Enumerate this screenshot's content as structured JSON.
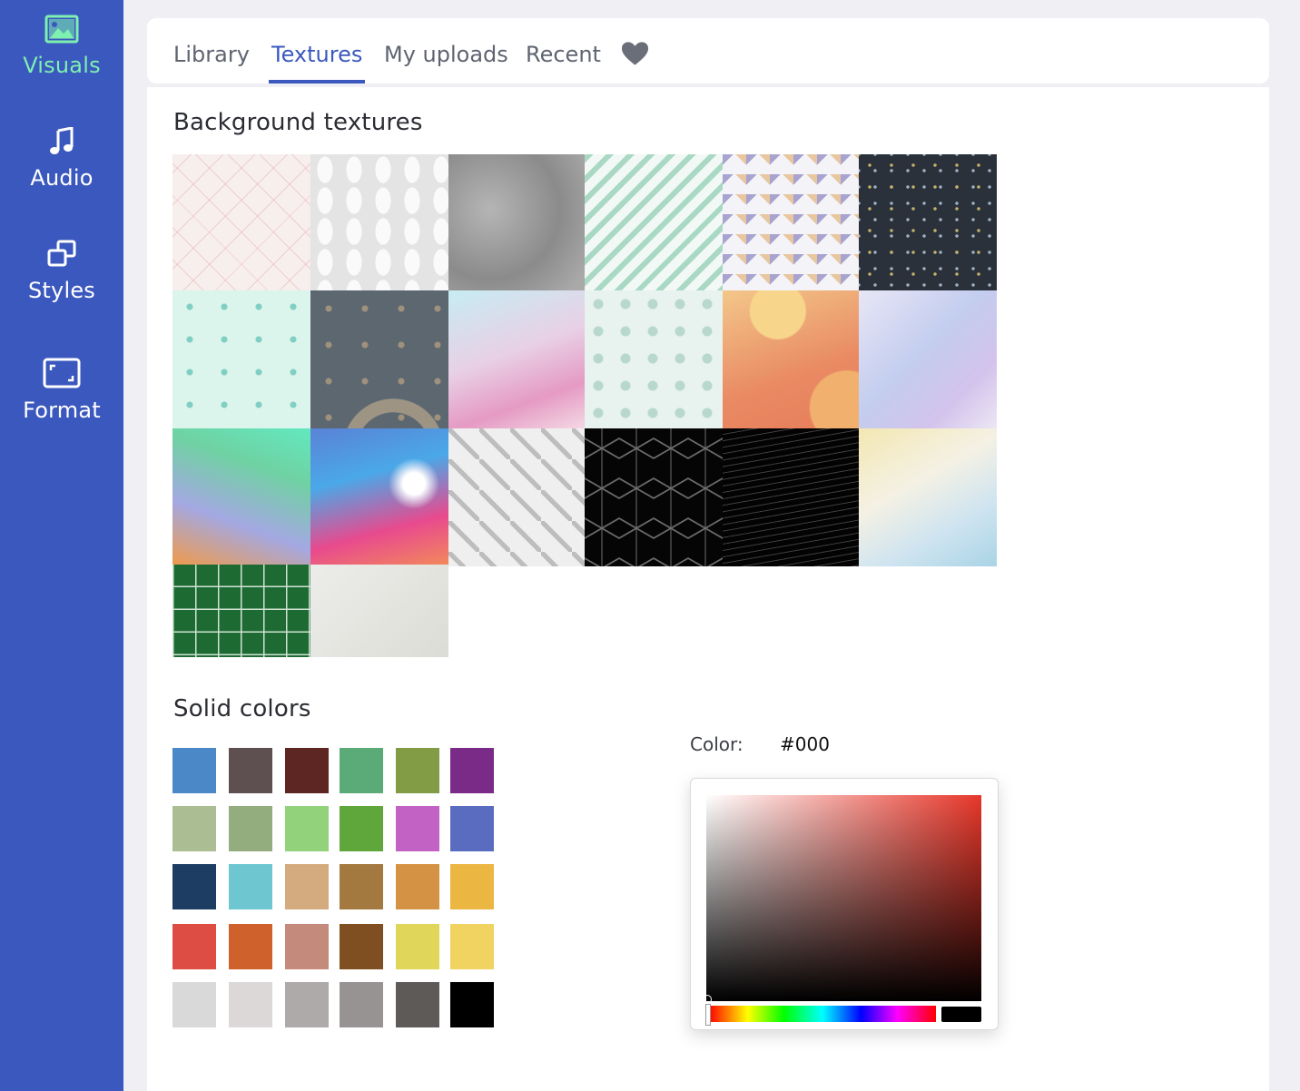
{
  "sidebar": {
    "items": [
      {
        "label": "Visuals",
        "icon": "image-icon",
        "active": true
      },
      {
        "label": "Audio",
        "icon": "music-note-icon"
      },
      {
        "label": "Styles",
        "icon": "layers-icon"
      },
      {
        "label": "Format",
        "icon": "aspect-ratio-icon"
      }
    ]
  },
  "tabs": {
    "items": [
      {
        "label": "Library"
      },
      {
        "label": "Textures",
        "active": true
      },
      {
        "label": "My uploads"
      },
      {
        "label": "Recent"
      }
    ],
    "favorites_icon": "heart-icon"
  },
  "textures": {
    "title": "Background textures",
    "items": [
      "pink-diamond-grid",
      "white-leaf-pattern",
      "grey-concrete",
      "mint-diagonal-stripes",
      "pastel-chevron",
      "dark-confetti",
      "mint-memphis",
      "slate-memphis",
      "pastel-gradient",
      "medical-icons",
      "peach-3d-shapes",
      "lavender-watercolor",
      "rainbow-gradient",
      "blue-pink-fluid",
      "sketch-cubes",
      "black-hex-cubes",
      "dark-wave-mesh",
      "yellow-blue-watercolor",
      "green-tiles",
      "paper-with-twigs"
    ]
  },
  "solid_colors": {
    "title": "Solid colors",
    "swatches": [
      "#4a88c8",
      "#5e5050",
      "#5e2622",
      "#5aab78",
      "#829c46",
      "#7a2b88",
      "#abbd92",
      "#93ad7e",
      "#92d27a",
      "#5fa73a",
      "#c262c4",
      "#5a6cbf",
      "#1d3d62",
      "#6ec6d0",
      "#d4ab7e",
      "#a47940",
      "#d49344",
      "#ecb642",
      "#dd4d44",
      "#ce612c",
      "#c48a7b",
      "#7f4f22",
      "#e0d65a",
      "#f0d360",
      "#d9d9d9",
      "#dcd8d8",
      "#aeaaaa",
      "#979392",
      "#5e5a58",
      "#000000"
    ]
  },
  "color_picker": {
    "label": "Color:",
    "value": "#000",
    "hue_color": "#e8372a"
  }
}
